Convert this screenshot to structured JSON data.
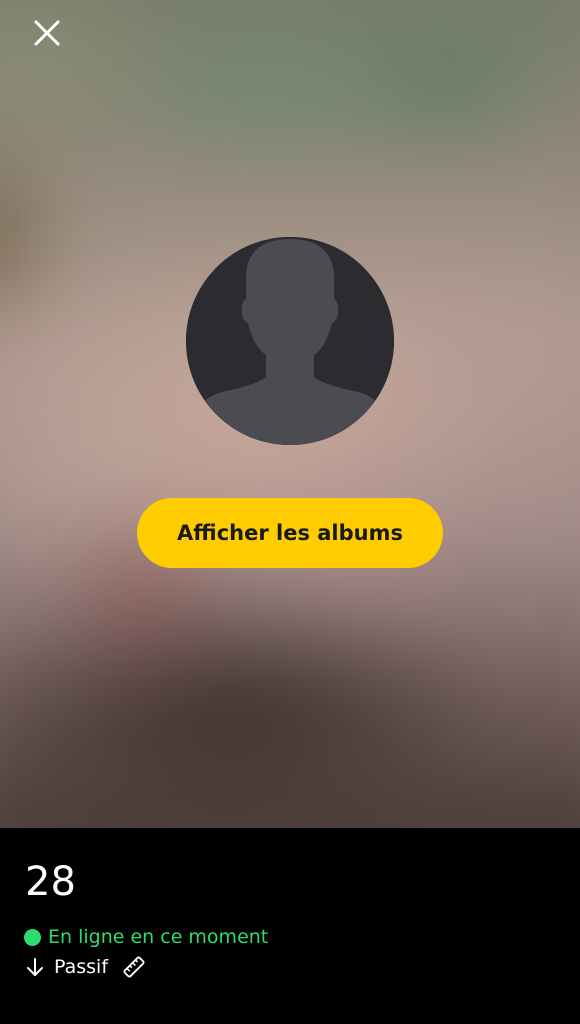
{
  "photo": {
    "close_icon": "close-icon"
  },
  "profile": {
    "avatar_icon": "person-silhouette-icon",
    "albums_button_label": "Afficher les albums",
    "albums_button_color": "#ffcc00"
  },
  "info": {
    "age": "28",
    "online_status": "En ligne en ce moment",
    "online_color": "#2bdc6e",
    "position_icon": "arrow-down-icon",
    "position": "Passif",
    "extra_icon": "ruler-icon"
  }
}
